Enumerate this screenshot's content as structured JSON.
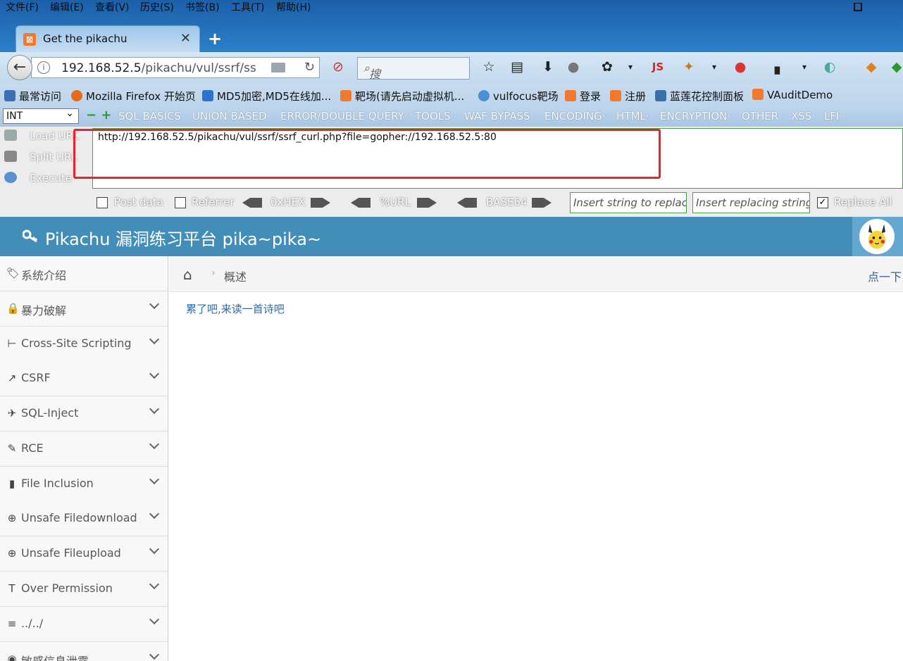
{
  "menubar": {
    "items": [
      "文件(F)",
      "编辑(E)",
      "查看(V)",
      "历史(S)",
      "书签(B)",
      "工具(T)",
      "帮助(H)"
    ]
  },
  "tab": {
    "title": "Get the pikachu",
    "close": "✕",
    "new_tab": "+"
  },
  "navbar": {
    "url_host": "192.168.52.5",
    "url_path": "/pikachu/vul/ssrf/ss",
    "search_placeholder": "搜索"
  },
  "bookmarks": [
    {
      "label": "最常访问",
      "icon_color": "#3a6fb5"
    },
    {
      "label": "Mozilla Firefox 开始页",
      "icon_color": "#e66a1a"
    },
    {
      "label": "MD5加密,MD5在线加...",
      "icon_color": "#2a74c9"
    },
    {
      "label": "靶场(请先启动虚拟机...",
      "icon_color": "#f2782d"
    },
    {
      "label": "vulfocus靶场",
      "icon_color": "#4b8fd6"
    },
    {
      "label": "登录",
      "icon_color": "#f2782d"
    },
    {
      "label": "注册",
      "icon_color": "#f2782d"
    },
    {
      "label": "蓝莲花控制面板",
      "icon_color": "#3b6fa8"
    },
    {
      "label": "VAuditDemo",
      "icon_color": "#f2782d"
    }
  ],
  "hackbar": {
    "select_value": "INT",
    "menus": [
      "SQL BASICS·",
      "UNION BASED·",
      "ERROR/DOUBLE QUERY·",
      "TOOLS·",
      "WAF BYPASS·",
      "ENCODING·",
      "HTML·",
      "ENCRYPTION·",
      "OTHER·",
      "XSS·",
      "LFI·"
    ],
    "load_url": "Load URL",
    "split_url": "Split URL",
    "execute": "Execute",
    "url_value": "http://192.168.52.5/pikachu/vul/ssrf/ssrf_curl.php?file=gopher://192.168.52.5:80",
    "post_data": "Post data",
    "referrer": "Referrer",
    "hex": "0xHEX",
    "urlenc": "%URL",
    "base64": "BASE64",
    "replace_placeholder": "Insert string to replace",
    "replacing_placeholder": "Insert replacing string",
    "replace_all": "Replace All"
  },
  "page": {
    "title": "Pikachu 漏洞练习平台 pika~pika~",
    "sidebar": [
      {
        "label": "系统介绍",
        "icon": "tags-icon",
        "glyph": "🏷",
        "expandable": false
      },
      {
        "label": "暴力破解",
        "icon": "lock-icon",
        "glyph": "🔒",
        "expandable": true
      },
      {
        "label": "Cross-Site Scripting",
        "icon": "sitemap-icon",
        "glyph": "⊢",
        "expandable": true
      },
      {
        "label": "CSRF",
        "icon": "share-icon",
        "glyph": "↗",
        "expandable": true
      },
      {
        "label": "SQL-Inject",
        "icon": "plane-icon",
        "glyph": "✈",
        "expandable": true
      },
      {
        "label": "RCE",
        "icon": "pencil-icon",
        "glyph": "✎",
        "expandable": true
      },
      {
        "label": "File Inclusion",
        "icon": "file-icon",
        "glyph": "▮",
        "expandable": true
      },
      {
        "label": "Unsafe Filedownload",
        "icon": "download-icon",
        "glyph": "⊕",
        "expandable": true
      },
      {
        "label": "Unsafe Fileupload",
        "icon": "upload-icon",
        "glyph": "⊕",
        "expandable": true
      },
      {
        "label": "Over Permission",
        "icon": "text-icon",
        "glyph": "T",
        "expandable": true
      },
      {
        "label": "../../",
        "icon": "align-icon",
        "glyph": "≡",
        "expandable": true
      },
      {
        "label": "敏感信息泄露",
        "icon": "camera-icon",
        "glyph": "◉",
        "expandable": true
      }
    ],
    "breadcrumb": {
      "home": "⌂",
      "current": "概述",
      "right_link": "点一下"
    },
    "poem_link": "累了吧,来读一首诗吧"
  }
}
